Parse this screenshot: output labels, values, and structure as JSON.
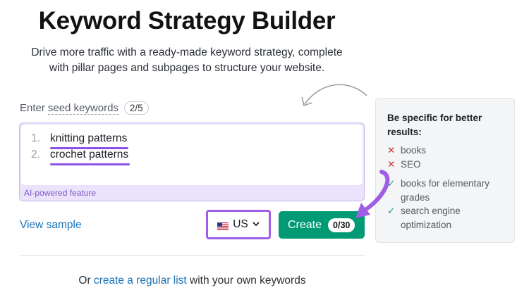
{
  "page": {
    "title": "Keyword Strategy Builder",
    "subtitle_line1": "Drive more traffic with a ready-made keyword strategy, complete",
    "subtitle_line2": "with pillar pages and subpages to structure your website."
  },
  "seed": {
    "label_prefix": "Enter",
    "label_link": "seed keywords",
    "count": "2/5",
    "keywords": [
      {
        "num": "1.",
        "text": "knitting patterns"
      },
      {
        "num": "2.",
        "text": "crochet patterns"
      }
    ],
    "ai_label": "AI-powered feature"
  },
  "actions": {
    "view_sample": "View sample",
    "country_code": "US",
    "country_flag_icon": "us-flag-icon",
    "create_label": "Create",
    "create_count": "0/30"
  },
  "footer": {
    "prefix": "Or",
    "link": "create a regular list",
    "suffix": "with your own keywords"
  },
  "tips": {
    "heading": "Be specific for better results:",
    "items": [
      {
        "mark": "✕",
        "kind": "bad",
        "text": "books"
      },
      {
        "mark": "✕",
        "kind": "bad",
        "text": "SEO"
      },
      {
        "mark": "✓",
        "kind": "good",
        "text": "books for elementary grades"
      },
      {
        "mark": "✓",
        "kind": "good",
        "text": "search engine optimization"
      }
    ]
  },
  "colors": {
    "accent_purple": "#8c53e6",
    "create_green": "#009a74",
    "link_blue": "#1a73b8",
    "bad_red": "#d3303b",
    "good_green": "#1aa67b"
  }
}
